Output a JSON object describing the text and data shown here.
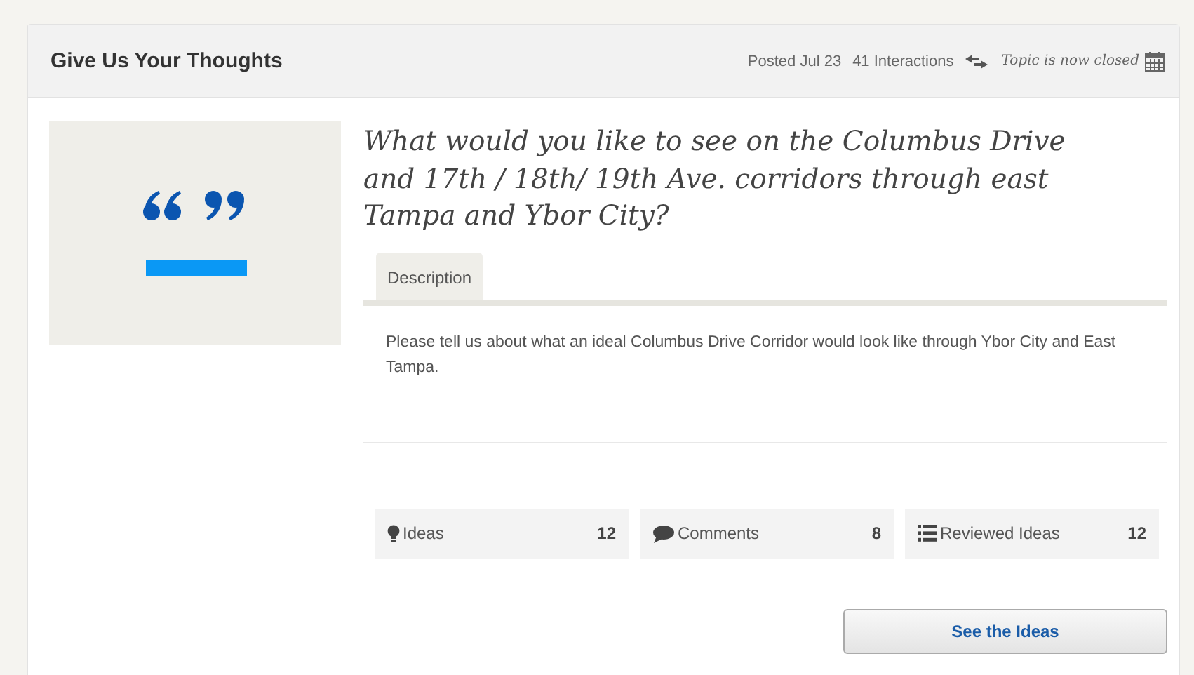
{
  "header": {
    "title": "Give Us Your Thoughts",
    "posted": "Posted Jul 23",
    "interactions": "41 Interactions",
    "status": "Topic is now closed"
  },
  "topic": {
    "question": "What would you like to see on the Columbus Drive and 17th / 18th/ 19th Ave. corridors through east Tampa and Ybor City?",
    "tabs": [
      {
        "label": "Description",
        "selected": true
      }
    ],
    "description": "Please tell us about what an ideal Columbus Drive Corridor would look like through Ybor City and East Tampa.",
    "stats": [
      {
        "kind": "ideas",
        "label": "Ideas",
        "count": "12"
      },
      {
        "kind": "comments",
        "label": "Comments",
        "count": "8"
      },
      {
        "kind": "reviewed",
        "label": "Reviewed Ideas",
        "count": "12"
      }
    ],
    "button": "See the Ideas"
  }
}
